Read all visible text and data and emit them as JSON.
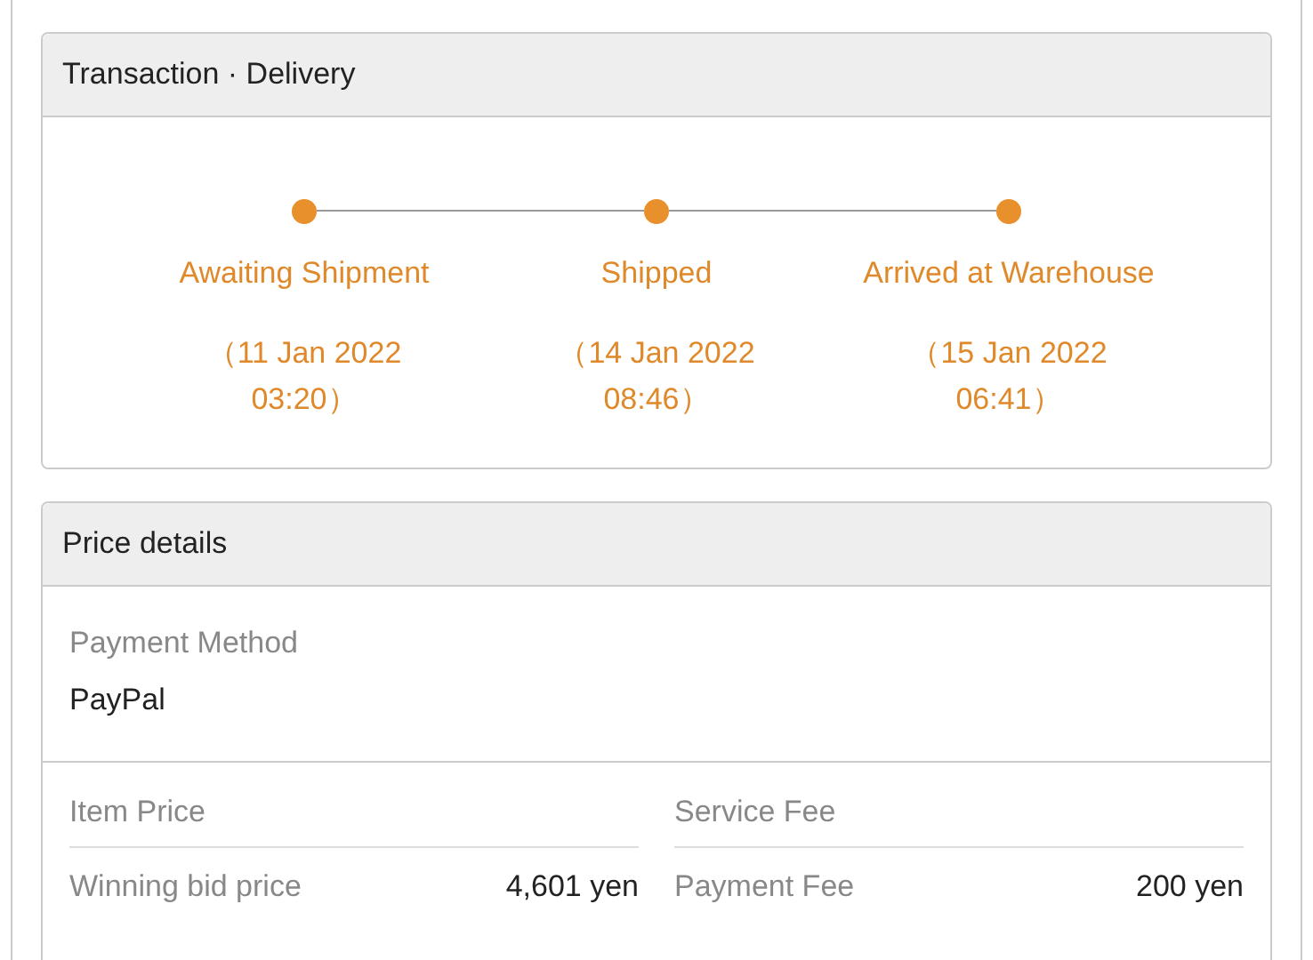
{
  "delivery": {
    "title": "Transaction · Delivery",
    "steps": [
      {
        "label": "Awaiting Shipment",
        "date": "（11 Jan 2022 03:20）",
        "done": true
      },
      {
        "label": "Shipped",
        "date": "（14 Jan 2022 08:46）",
        "done": true
      },
      {
        "label": "Arrived at Warehouse",
        "date": "（15 Jan 2022 06:41）",
        "done": true
      }
    ]
  },
  "price_details": {
    "title": "Price details",
    "payment_method": {
      "label": "Payment Method",
      "value": "PayPal"
    },
    "columns": [
      {
        "heading": "Item Price",
        "rows": [
          {
            "label": "Winning bid price",
            "value": "4,601 yen"
          }
        ]
      },
      {
        "heading": "Service Fee",
        "rows": [
          {
            "label": "Payment Fee",
            "value": "200 yen"
          }
        ]
      }
    ]
  }
}
